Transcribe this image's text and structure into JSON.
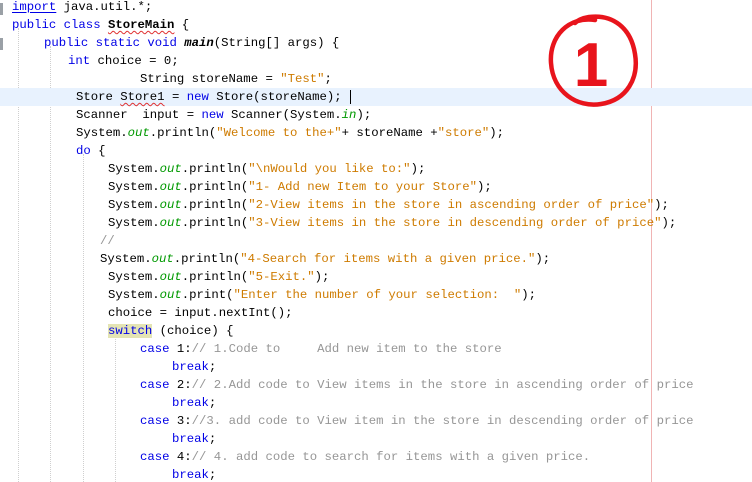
{
  "editor": {
    "lines": [
      {
        "indent": 12,
        "parts": [
          {
            "t": "import",
            "c": "kw ul"
          },
          {
            "t": " java.util.*;"
          }
        ]
      },
      {
        "indent": 12,
        "parts": [
          {
            "t": "public",
            "c": "kw"
          },
          {
            "t": " "
          },
          {
            "t": "class",
            "c": "kw"
          },
          {
            "t": " "
          },
          {
            "t": "StoreMain",
            "c": "bold squig"
          },
          {
            "t": " {"
          }
        ]
      },
      {
        "indent": 44,
        "parts": [
          {
            "t": "public",
            "c": "kw"
          },
          {
            "t": " "
          },
          {
            "t": "static",
            "c": "kw"
          },
          {
            "t": " "
          },
          {
            "t": "void",
            "c": "kw"
          },
          {
            "t": " "
          },
          {
            "t": "main",
            "c": "bold it"
          },
          {
            "t": "(String[] args) {"
          }
        ]
      },
      {
        "indent": 68,
        "parts": [
          {
            "t": "int",
            "c": "kw"
          },
          {
            "t": " choice = 0;"
          }
        ]
      },
      {
        "indent": 140,
        "parts": [
          {
            "t": "String storeName = "
          },
          {
            "t": "\"Test\"",
            "c": "str"
          },
          {
            "t": ";"
          }
        ]
      },
      {
        "indent": 76,
        "current": true,
        "caret": true,
        "parts": [
          {
            "t": "Store "
          },
          {
            "t": "Store1",
            "c": "squig"
          },
          {
            "t": " = "
          },
          {
            "t": "new",
            "c": "kw"
          },
          {
            "t": " Store(storeName);"
          }
        ]
      },
      {
        "indent": 76,
        "parts": [
          {
            "t": "Scanner  input = "
          },
          {
            "t": "new",
            "c": "kw"
          },
          {
            "t": " Scanner(System."
          },
          {
            "t": "in",
            "c": "fld"
          },
          {
            "t": ");"
          }
        ]
      },
      {
        "indent": 76,
        "parts": [
          {
            "t": "System."
          },
          {
            "t": "out",
            "c": "fld"
          },
          {
            "t": ".println("
          },
          {
            "t": "\"Welcome to the+\"",
            "c": "str"
          },
          {
            "t": "+ storeName +"
          },
          {
            "t": "\"store\"",
            "c": "str"
          },
          {
            "t": ");"
          }
        ]
      },
      {
        "indent": 76,
        "parts": [
          {
            "t": "do",
            "c": "kw"
          },
          {
            "t": " {"
          }
        ]
      },
      {
        "indent": 108,
        "parts": [
          {
            "t": "System."
          },
          {
            "t": "out",
            "c": "fld"
          },
          {
            "t": ".println("
          },
          {
            "t": "\"\\nWould you like to:\"",
            "c": "str"
          },
          {
            "t": ");"
          }
        ]
      },
      {
        "indent": 108,
        "parts": [
          {
            "t": "System."
          },
          {
            "t": "out",
            "c": "fld"
          },
          {
            "t": ".println("
          },
          {
            "t": "\"1- Add new Item to your Store\"",
            "c": "str"
          },
          {
            "t": ");"
          }
        ]
      },
      {
        "indent": 108,
        "parts": [
          {
            "t": "System."
          },
          {
            "t": "out",
            "c": "fld"
          },
          {
            "t": ".println("
          },
          {
            "t": "\"2-View items in the store in ascending order of price\"",
            "c": "str"
          },
          {
            "t": ");"
          }
        ]
      },
      {
        "indent": 108,
        "parts": [
          {
            "t": "System."
          },
          {
            "t": "out",
            "c": "fld"
          },
          {
            "t": ".println("
          },
          {
            "t": "\"3-View items in the store in descending order of price\"",
            "c": "str"
          },
          {
            "t": ");"
          }
        ]
      },
      {
        "indent": 100,
        "parts": [
          {
            "t": "//",
            "c": "cm"
          }
        ]
      },
      {
        "indent": 100,
        "parts": [
          {
            "t": "System."
          },
          {
            "t": "out",
            "c": "fld"
          },
          {
            "t": ".println("
          },
          {
            "t": "\"4-Search for items with a given price.\"",
            "c": "str"
          },
          {
            "t": ");"
          }
        ]
      },
      {
        "indent": 108,
        "parts": [
          {
            "t": "System."
          },
          {
            "t": "out",
            "c": "fld"
          },
          {
            "t": ".println("
          },
          {
            "t": "\"5-Exit.\"",
            "c": "str"
          },
          {
            "t": ");"
          }
        ]
      },
      {
        "indent": 108,
        "parts": [
          {
            "t": "System."
          },
          {
            "t": "out",
            "c": "fld"
          },
          {
            "t": ".print("
          },
          {
            "t": "\"Enter the number of your selection:  \"",
            "c": "str"
          },
          {
            "t": ");"
          }
        ]
      },
      {
        "indent": 108,
        "parts": [
          {
            "t": "choice = input.nextInt();"
          }
        ]
      },
      {
        "indent": 108,
        "parts": [
          {
            "t": "switch",
            "c": "kw hl"
          },
          {
            "t": " (choice) {"
          }
        ]
      },
      {
        "indent": 140,
        "parts": [
          {
            "t": "case",
            "c": "kw"
          },
          {
            "t": " 1:"
          },
          {
            "t": "// 1.Code to     Add new item to the store",
            "c": "cm"
          }
        ]
      },
      {
        "indent": 172,
        "parts": [
          {
            "t": "break",
            "c": "kw"
          },
          {
            "t": ";"
          }
        ]
      },
      {
        "indent": 140,
        "parts": [
          {
            "t": "case",
            "c": "kw"
          },
          {
            "t": " 2:"
          },
          {
            "t": "// 2.Add code to View items in the store in ascending order of price",
            "c": "cm"
          }
        ]
      },
      {
        "indent": 172,
        "parts": [
          {
            "t": "break",
            "c": "kw"
          },
          {
            "t": ";"
          }
        ]
      },
      {
        "indent": 140,
        "parts": [
          {
            "t": "case",
            "c": "kw"
          },
          {
            "t": " 3:"
          },
          {
            "t": "//3. add code to View item in the store in descending order of price",
            "c": "cm"
          }
        ]
      },
      {
        "indent": 172,
        "parts": [
          {
            "t": "break",
            "c": "kw"
          },
          {
            "t": ";"
          }
        ]
      },
      {
        "indent": 140,
        "parts": [
          {
            "t": "case",
            "c": "kw"
          },
          {
            "t": " 4:"
          },
          {
            "t": "// 4. add code to search for items with a given price.",
            "c": "cm"
          }
        ]
      },
      {
        "indent": 172,
        "parts": [
          {
            "t": "break",
            "c": "kw"
          },
          {
            "t": ";"
          }
        ]
      }
    ]
  },
  "annotation": {
    "label": "1",
    "color": "#e8141c"
  }
}
